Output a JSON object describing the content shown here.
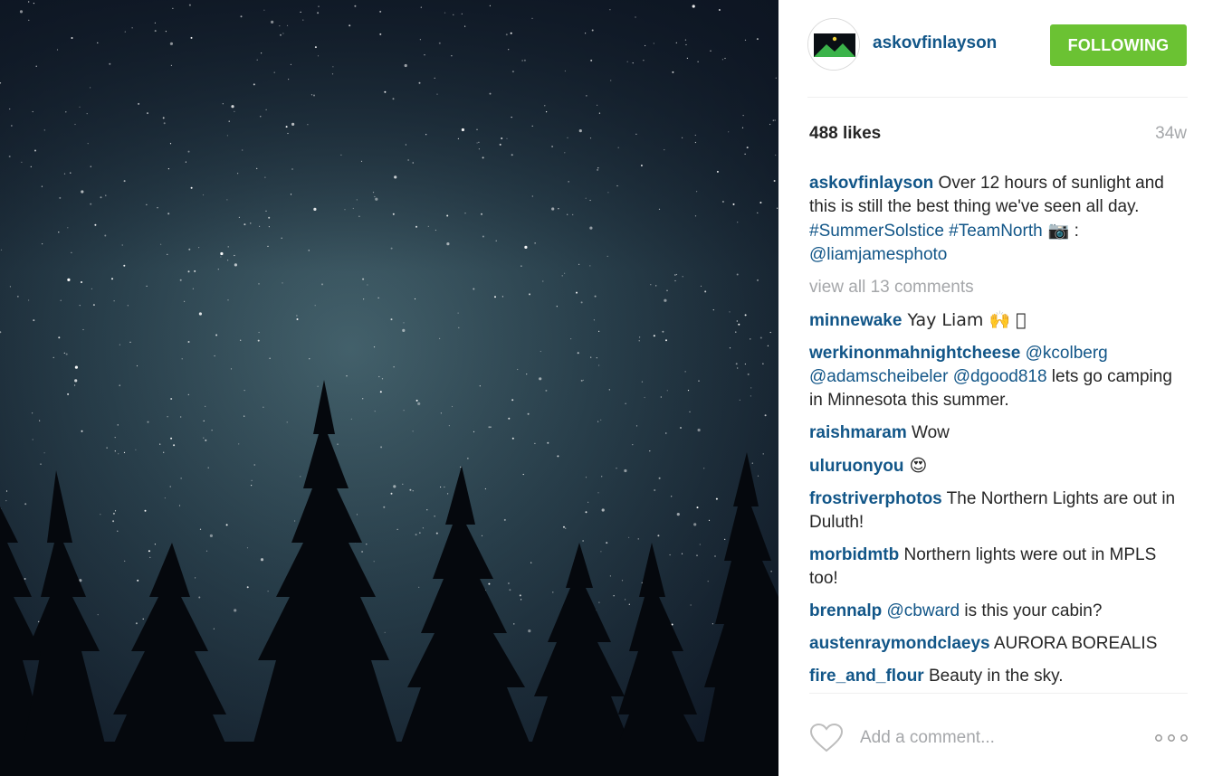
{
  "post": {
    "username": "askovfinlayson",
    "follow_label": "FOLLOWING",
    "likes": "488 likes",
    "age": "34w",
    "view_all": "view all 13 comments",
    "add_comment_placeholder": "Add a comment..."
  },
  "caption": {
    "user": "askovfinlayson",
    "text": " Over 12 hours of sunlight and this is still the best thing we've seen all day. ",
    "tag1": "#SummerSolstice",
    "tag2": "#TeamNorth",
    "camera": " 📷",
    "sep": " : ",
    "mention": "@liamjamesphoto"
  },
  "comments": [
    {
      "user": "minnewake",
      "text": " Yay Liam 🙌 🏼"
    },
    {
      "user": "werkinonmahnightcheese",
      "m1": "@kcolberg",
      "m2": "@adamscheibeler",
      "m3": "@dgood818",
      "text": " lets go camping in Minnesota this summer."
    },
    {
      "user": "raishmaram",
      "text": " Wow"
    },
    {
      "user": "uluruonyou",
      "text": " 😍"
    },
    {
      "user": "frostriverphotos",
      "text": " The Northern Lights are out in Duluth!"
    },
    {
      "user": "morbidmtb",
      "text": " Northern lights were out in MPLS too!"
    },
    {
      "user": "brennalp",
      "mention": "@cbward",
      "text": " is this your cabin?"
    },
    {
      "user": "austenraymondclaeys",
      "text": " AURORA BOREALIS"
    },
    {
      "user": "fire_and_flour",
      "text": " Beauty in the sky."
    }
  ],
  "icons": {
    "heart": "heart-outline-icon",
    "more": "more-options-icon"
  },
  "colors": {
    "link": "#125688",
    "follow": "#6bc233",
    "muted": "#a5a7aa"
  }
}
